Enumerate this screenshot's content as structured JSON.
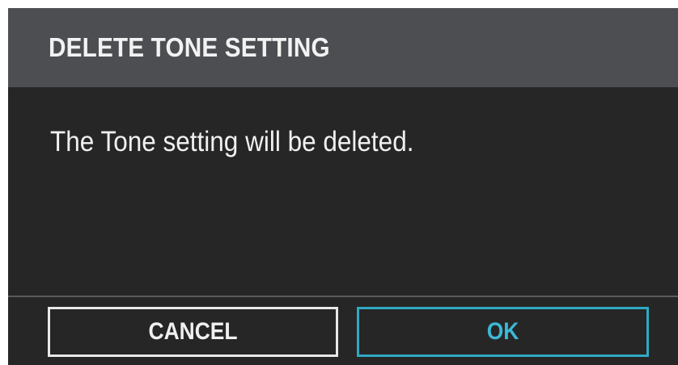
{
  "dialog": {
    "title": "DELETE TONE SETTING",
    "message": "The Tone setting will be deleted.",
    "buttons": {
      "cancel_label": "CANCEL",
      "ok_label": "OK"
    }
  },
  "colors": {
    "header_background": "#4c4e52",
    "body_background": "#262626",
    "text": "#f0f0f0",
    "ok_accent": "#2fa9c4"
  }
}
